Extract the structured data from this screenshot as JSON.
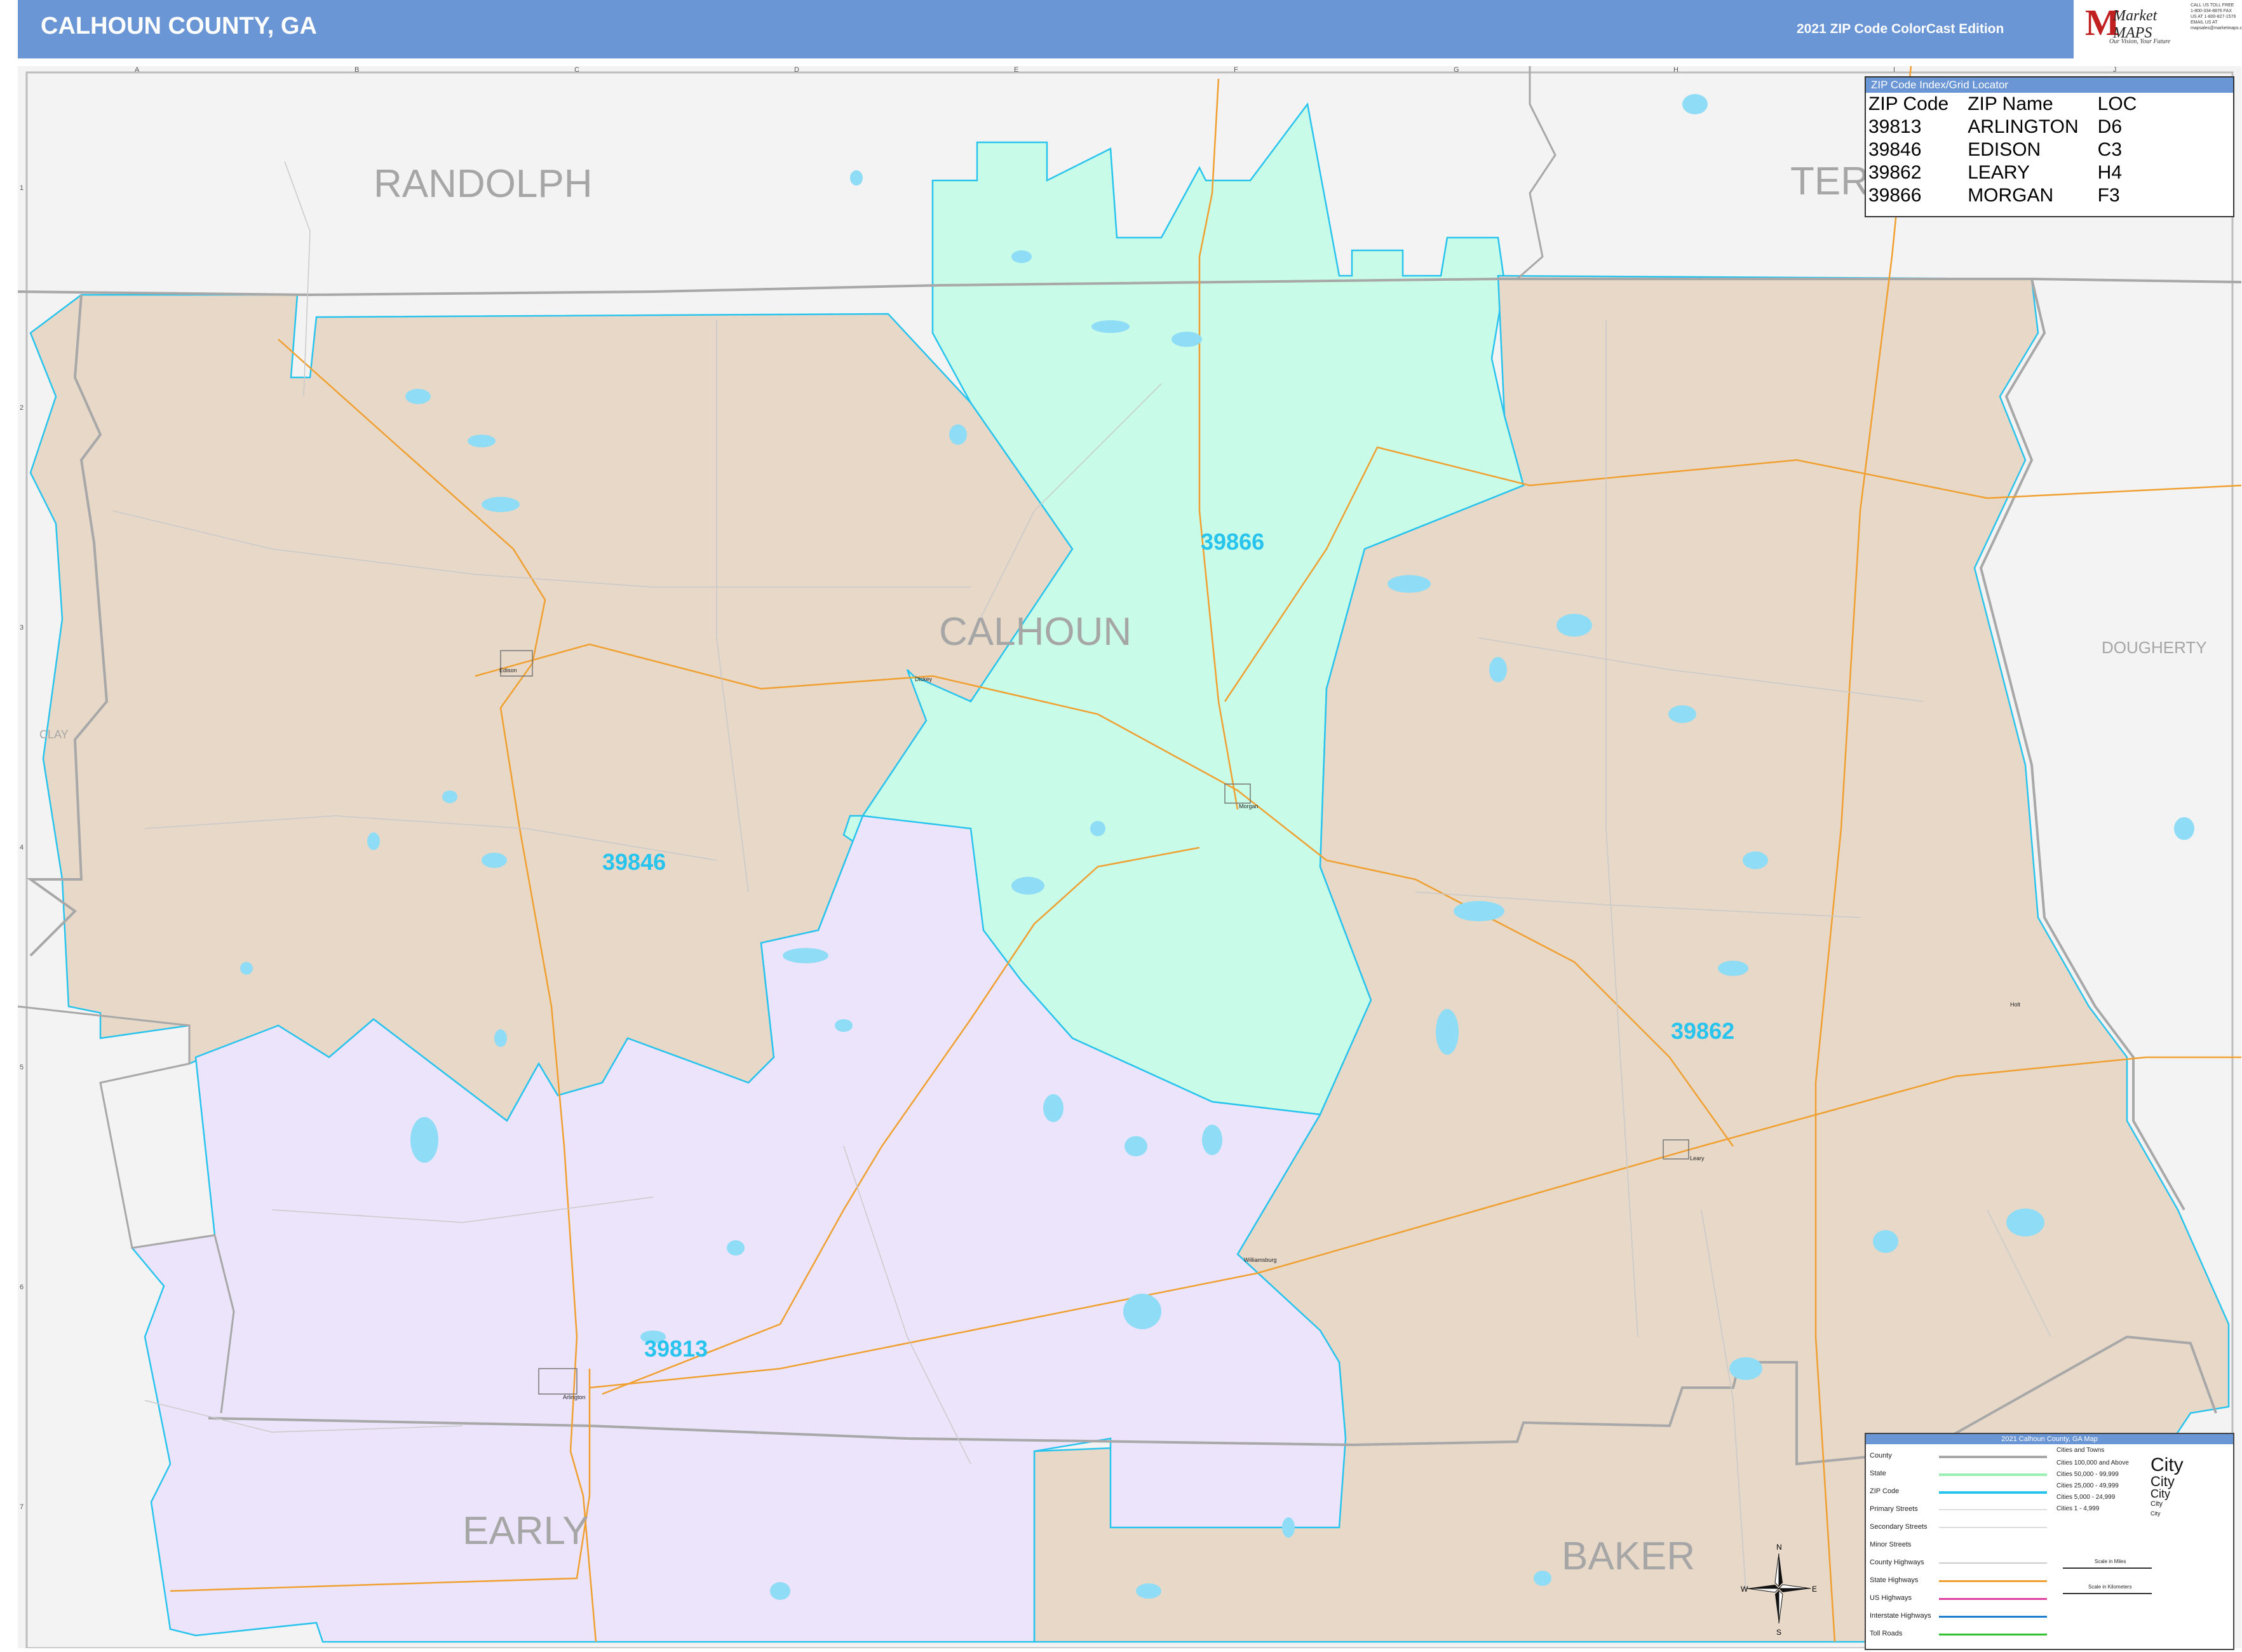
{
  "header": {
    "title": "CALHOUN COUNTY, GA",
    "edition": "2021 ZIP Code ColorCast Edition",
    "logo_text": "Market MAPS",
    "logo_tagline": "Our Vision, Your Future",
    "contact_text": "CALL US TOLL FREE 1-800-334-8876 FAX US AT 1-800-827-1576 EMAIL US AT mapsales@marketmaps.com"
  },
  "colors": {
    "header_bg": "#6b96d6",
    "zip_39846": "#e8d8c8",
    "zip_39862": "#e8d8c8",
    "zip_39866": "#c8fbe8",
    "zip_39813": "#ece4fb",
    "zip_border": "#29c4ee",
    "county_border": "#a8a8a8",
    "water": "#8fdcf6",
    "state_highway": "#f0a030",
    "outside_area": "#f3f3f3"
  },
  "map": {
    "counties": {
      "randolph": "RANDOLPH",
      "terrell": "TER",
      "calhoun": "CALHOUN",
      "dougherty": "DOUGHERTY",
      "clay": "CLAY",
      "early": "EARLY",
      "baker": "BAKER"
    },
    "zip_labels": {
      "z39866": "39866",
      "z39846": "39846",
      "z39862": "39862",
      "z39813": "39813"
    },
    "places": {
      "edison": "Edison",
      "dickey": "Dickey",
      "morgan": "Morgan",
      "leary": "Leary",
      "williamsburg": "Williamsburg",
      "arlington": "Arlington",
      "hoggard": "Holt"
    },
    "grid_columns": [
      "A",
      "B",
      "C",
      "D",
      "E",
      "F",
      "G",
      "H",
      "I",
      "J"
    ],
    "grid_rows": [
      "1",
      "2",
      "3",
      "4",
      "5",
      "6",
      "7"
    ]
  },
  "zip_index": {
    "title": "ZIP Code Index/Grid Locator",
    "headers": [
      "ZIP Code",
      "ZIP Name",
      "LOC"
    ],
    "rows": [
      [
        "39813",
        "ARLINGTON",
        "D6"
      ],
      [
        "39846",
        "EDISON",
        "C3"
      ],
      [
        "39862",
        "LEARY",
        "H4"
      ],
      [
        "39866",
        "MORGAN",
        "F3"
      ]
    ]
  },
  "legend": {
    "title": "2021 Calhoun County, GA Map",
    "items": [
      "County",
      "State",
      "ZIP Code",
      "Primary Streets",
      "Secondary Streets",
      "Minor Streets",
      "County Highways",
      "State Highways",
      "US Highways",
      "Interstate Highways",
      "Toll Roads"
    ],
    "cities_header": "Cities and Towns",
    "city_ranges": [
      "Cities 100,000 and Above",
      "Cities 50,000 - 99,999",
      "Cities 25,000 - 49,999",
      "Cities 5,000 - 24,999",
      "Cities 1 - 4,999"
    ],
    "city_label": "City",
    "scale_miles": "Scale in Miles",
    "scale_km": "Scale in Kilometers",
    "compass": {
      "n": "N",
      "s": "S",
      "e": "E",
      "w": "W"
    }
  }
}
